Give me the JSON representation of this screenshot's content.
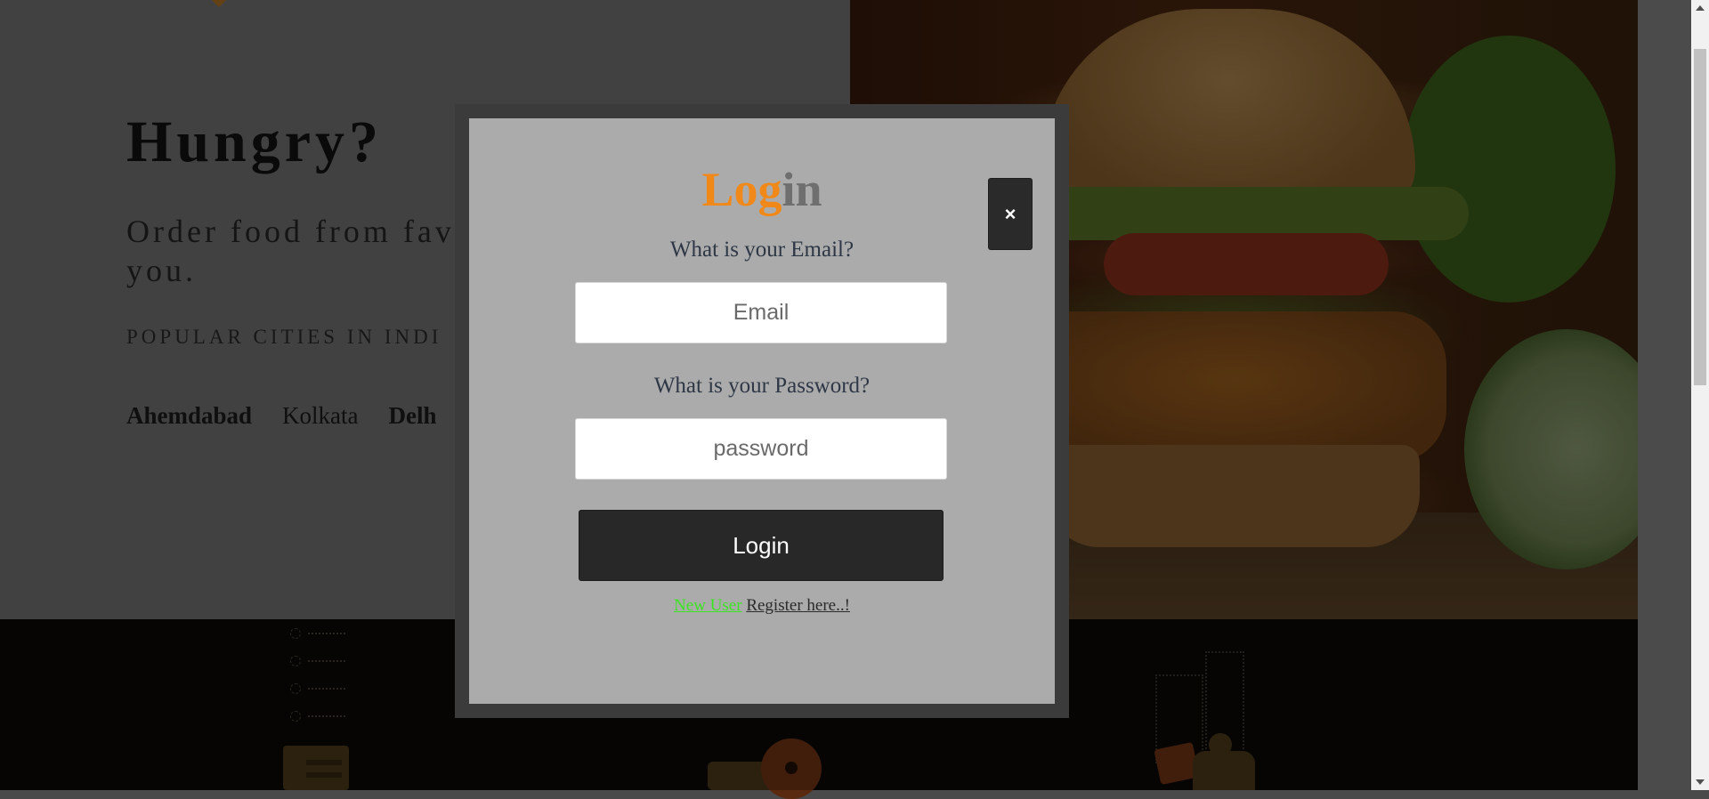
{
  "hero": {
    "title": "Hungry?",
    "subtitle": "Order food from fav\nyou.",
    "cities_heading": "POPULAR CITIES IN INDI",
    "cities": [
      "Ahemdabad",
      "Kolkata",
      "Delh"
    ]
  },
  "modal": {
    "title_part1": "Log",
    "title_part2": "in",
    "close_label": "×",
    "email_label": "What is your Email?",
    "email_placeholder": "Email",
    "email_value": "",
    "password_label": "What is your Password?",
    "password_placeholder": "password",
    "password_value": "",
    "login_label": "Login",
    "new_user_text": "New User",
    "register_text": "Register here..!"
  },
  "colors": {
    "accent": "#f0891a",
    "title_secondary": "#6f6f6f",
    "new_user": "#39e61f",
    "button_dark": "#282828",
    "modal_bg": "#ababab"
  },
  "icons": {
    "close": "close-icon",
    "caret": "caret-down-icon",
    "checklist": "checklist-icon",
    "location_pin": "location-pin-icon",
    "delivery_rider": "delivery-rider-icon"
  }
}
